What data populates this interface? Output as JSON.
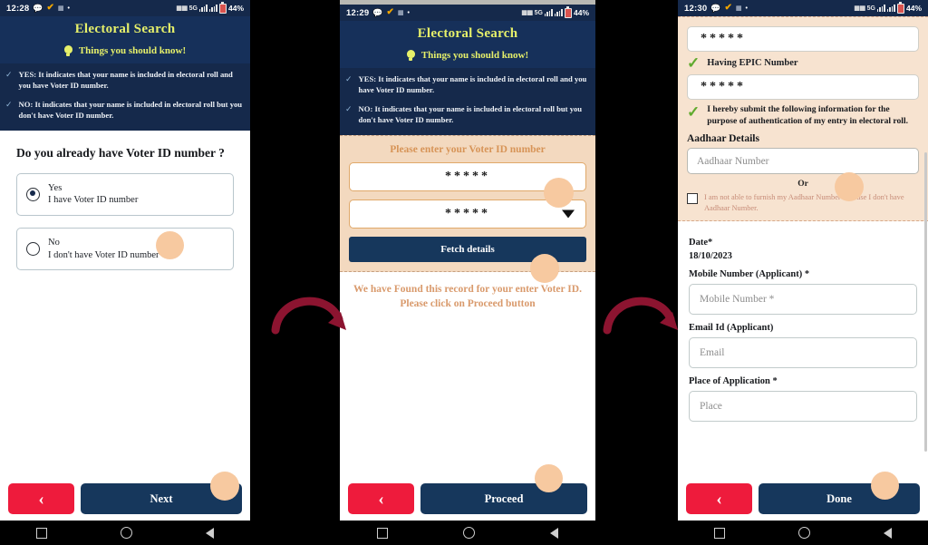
{
  "panels": [
    {
      "id": "panel-1",
      "statusbar": {
        "time": "12:28",
        "network": "5G",
        "battery_pct": "44%"
      },
      "header": {
        "app_title": "Electoral Search",
        "know_text": "Things you should know!"
      },
      "notes": [
        "YES: It indicates that your name is included in electoral roll and you have Voter ID number.",
        "NO: It indicates that your name is included in electoral roll but you don't have Voter ID number."
      ],
      "question": "Do you already have Voter ID number ?",
      "options": [
        {
          "title": "Yes",
          "subtitle": "I have Voter ID number",
          "selected": true
        },
        {
          "title": "No",
          "subtitle": "I don't have Voter ID number",
          "selected": false
        }
      ],
      "bottom": {
        "back_label": "‹",
        "main_label": "Next"
      }
    },
    {
      "id": "panel-2",
      "statusbar": {
        "time": "12:29",
        "network": "5G",
        "battery_pct": "44%"
      },
      "header": {
        "app_title": "Electoral Search",
        "know_text": "Things you should know!"
      },
      "notes": [
        "YES: It indicates that your name is included in electoral roll and you have Voter ID number.",
        "NO: It indicates that your name is included in electoral roll but you don't have Voter ID number."
      ],
      "card": {
        "title": "Please enter your Voter ID number",
        "voter_id_value": "*****",
        "state_value": "*****",
        "fetch_label": "Fetch details"
      },
      "found_message": "We have Found this record for your enter Voter ID. Please click on Proceed button",
      "bottom": {
        "back_label": "‹",
        "main_label": "Proceed"
      }
    },
    {
      "id": "panel-3",
      "statusbar": {
        "time": "12:30",
        "network": "5G",
        "battery_pct": "44%"
      },
      "tan": {
        "top_field_value": "*****",
        "epic_label": "Having EPIC Number",
        "epic_field_value": "*****",
        "hereby_text": "I hereby submit the following information for the purpose of authentication of my entry in electoral roll.",
        "aadhaar_heading": "Aadhaar Details",
        "aadhaar_placeholder": "Aadhaar Number",
        "or_label": "Or",
        "checkbox_text": "I am not able to furnish my Aadhaar Number because I don't have Aadhaar Number."
      },
      "form": [
        {
          "label": "Date*",
          "value": "18/10/2023",
          "type": "text"
        },
        {
          "label": "Mobile Number (Applicant) *",
          "placeholder": "Mobile Number *",
          "type": "input"
        },
        {
          "label": "Email Id (Applicant)",
          "placeholder": "Email",
          "type": "input"
        },
        {
          "label": "Place of Application *",
          "placeholder": "Place",
          "type": "input"
        }
      ],
      "bottom": {
        "back_label": "‹",
        "main_label": "Done"
      }
    }
  ],
  "colors": {
    "navy": "#15294b",
    "navy_header": "#16305a",
    "yellow": "#e6f06a",
    "red": "#ee1b3c",
    "button_navy": "#16375c",
    "tan": "#f3d9bf",
    "tan_light": "#f7e3d0",
    "orange_text": "#d79457",
    "blob": "#f7c9a0",
    "arrow": "#8c1430"
  }
}
